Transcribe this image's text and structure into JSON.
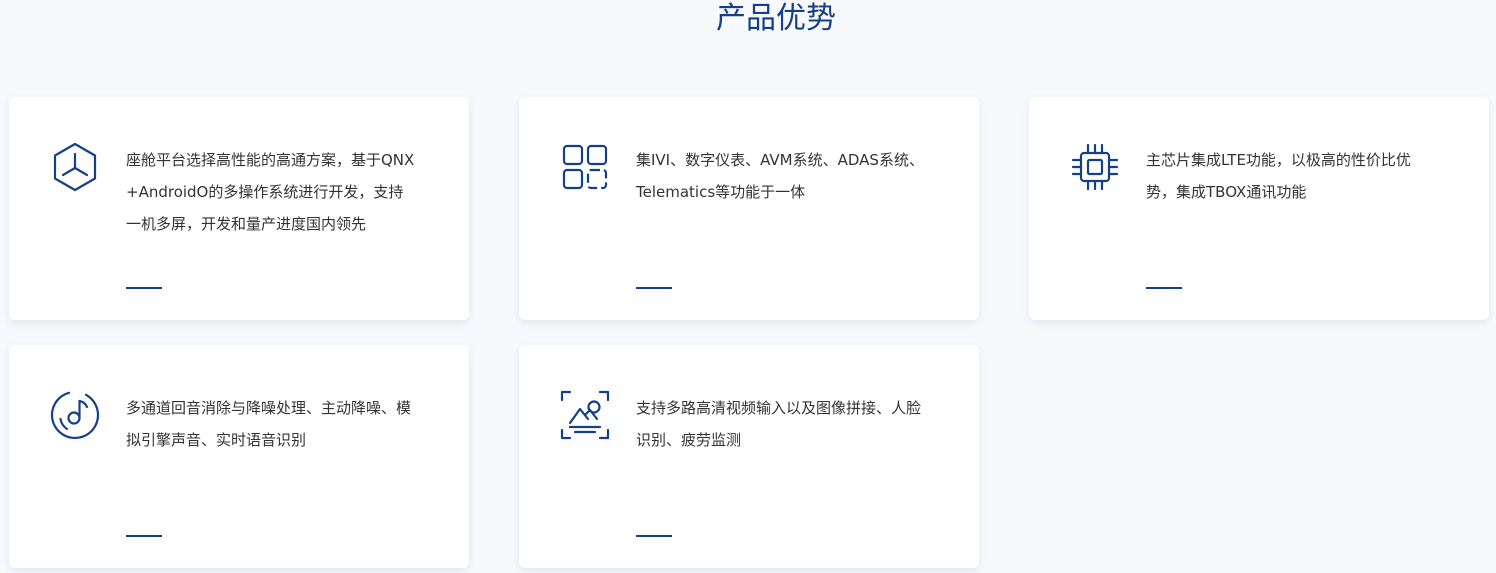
{
  "section": {
    "title": "产品优势"
  },
  "colors": {
    "accent": "#153f86",
    "page_background": "#f7f9fc",
    "card_background": "#ffffff",
    "text": "#333333"
  },
  "cards": [
    {
      "icon": "hexagon-network-icon",
      "text": "座舱平台选择高性能的高通方案，基于QNX+AndroidO的多操作系统进行开发，支持一机多屏，开发和量产进度国内领先"
    },
    {
      "icon": "grid-apps-icon",
      "text": "集IVI、数字仪表、AVM系统、ADAS系统、 Telematics等功能于一体"
    },
    {
      "icon": "chip-icon",
      "text": "主芯片集成LTE功能，以极高的性价比优势，集成TBOX通讯功能"
    },
    {
      "icon": "music-disc-icon",
      "text": "多通道回音消除与降噪处理、主动降噪、模拟引擎声音、实时语音识别"
    },
    {
      "icon": "image-scan-icon",
      "text": "支持多路高清视频输入以及图像拼接、人脸识别、疲劳监测"
    }
  ]
}
